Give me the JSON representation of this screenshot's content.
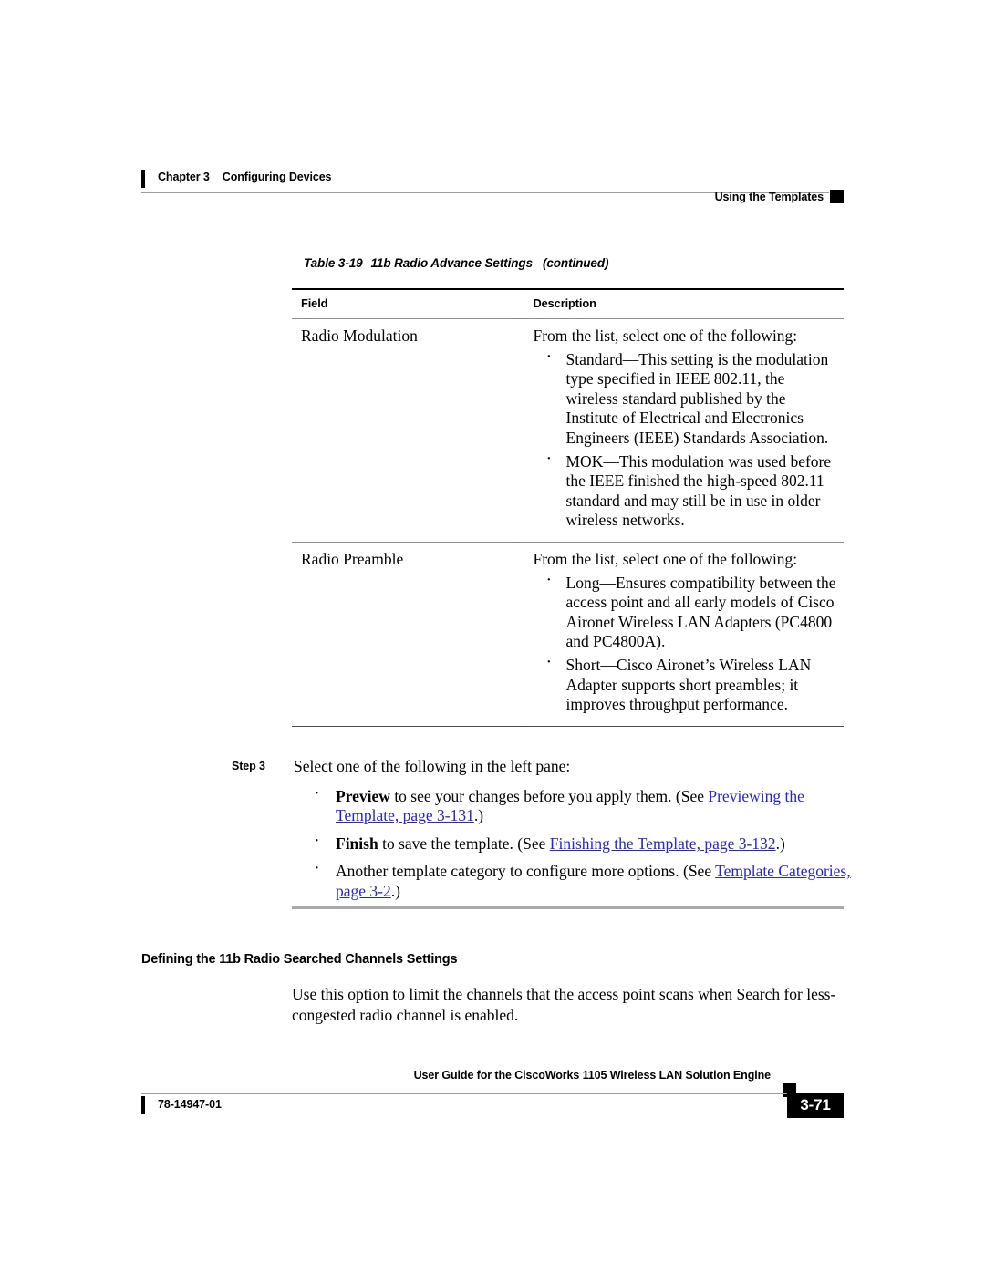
{
  "header": {
    "chapter": "Chapter 3",
    "chapter_title": "Configuring Devices",
    "running_head": "Using the Templates"
  },
  "table": {
    "caption_label": "Table 3-19",
    "caption_title": "11b Radio Advance Settings",
    "caption_continued": "(continued)",
    "columns": [
      "Field",
      "Description"
    ],
    "rows": [
      {
        "field": "Radio Modulation",
        "lead": "From the list, select one of the following:",
        "bullets": [
          "Standard—This setting is the modulation type specified in IEEE 802.11, the wireless standard published by the Institute of Electrical and Electronics Engineers (IEEE) Standards Association.",
          "MOK—This modulation was used before the IEEE finished the high-speed 802.11 standard and may still be in use in older wireless networks."
        ]
      },
      {
        "field": "Radio Preamble",
        "lead": "From the list, select one of the following:",
        "bullets": [
          "Long—Ensures compatibility between the access point and all early models of Cisco Aironet Wireless LAN Adapters (PC4800 and PC4800A).",
          "Short—Cisco Aironet’s Wireless LAN Adapter supports short preambles; it improves throughput performance."
        ]
      }
    ]
  },
  "step": {
    "label": "Step 3",
    "intro": "Select one of the following in the left pane:",
    "items": [
      {
        "bold": "Preview",
        "text": " to see your changes before you apply them. (See ",
        "link": "Previewing the Template, page 3-131",
        "tail": ".)"
      },
      {
        "bold": "Finish",
        "text": " to save the template. (See ",
        "link": "Finishing the Template, page 3-132",
        "tail": ".)"
      },
      {
        "bold": "",
        "text": "Another template category to configure more options. (See ",
        "link": "Template Categories, page 3-2",
        "tail": ".)"
      }
    ]
  },
  "section": {
    "heading": "Defining the 11b Radio Searched Channels Settings",
    "body": "Use this option to limit the channels that the access point scans when Search for less-congested radio channel is enabled."
  },
  "footer": {
    "guide_title": "User Guide for the CiscoWorks 1105 Wireless LAN Solution Engine",
    "doc_number": "78-14947-01",
    "page_number": "3-71"
  },
  "colors": {
    "xref_link": "#2424dd",
    "rule_gray": "#9d9d9d",
    "table_rule": "#8c8c8c"
  }
}
